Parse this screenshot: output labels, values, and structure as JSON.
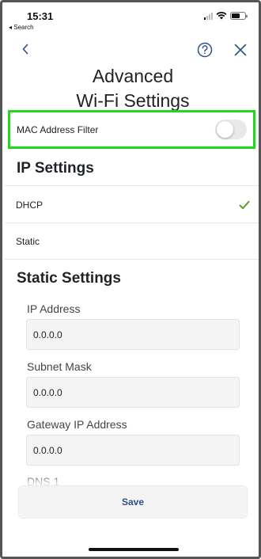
{
  "status_bar": {
    "time": "15:31",
    "back_label": "◂ Search"
  },
  "nav": {
    "back_icon": "chevron-left-icon",
    "help_icon": "help-circle-icon",
    "close_icon": "close-icon"
  },
  "title": {
    "line1": "Advanced",
    "line2": "Wi-Fi Settings"
  },
  "mac_filter": {
    "label": "MAC Address Filter",
    "enabled": false,
    "highlight_color": "#22d81d"
  },
  "ip_settings": {
    "title": "IP Settings",
    "options": [
      {
        "label": "DHCP",
        "selected": true
      },
      {
        "label": "Static",
        "selected": false
      }
    ],
    "check_color": "#5a9a2b"
  },
  "static_settings": {
    "title": "Static Settings",
    "fields": [
      {
        "label": "IP Address",
        "value": "0.0.0.0"
      },
      {
        "label": "Subnet Mask",
        "value": "0.0.0.0"
      },
      {
        "label": "Gateway IP Address",
        "value": "0.0.0.0"
      },
      {
        "label": "DNS 1",
        "value": ""
      }
    ]
  },
  "save_label": "Save",
  "accent_color": "#2f4f8a"
}
